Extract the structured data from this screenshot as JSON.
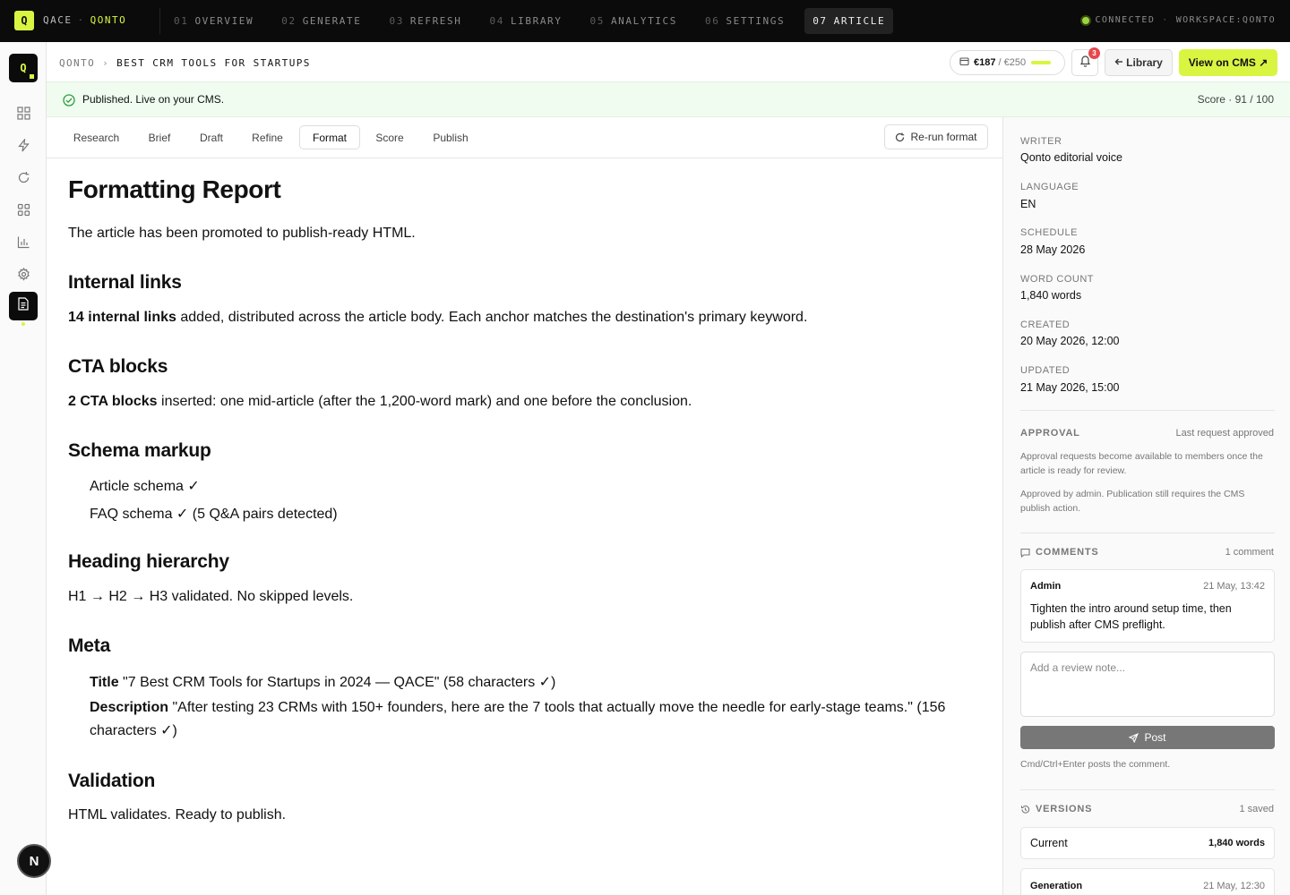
{
  "topbar": {
    "logo": "Q",
    "brand": "QACE",
    "separator": "·",
    "workspace": "QONTO",
    "nav": [
      {
        "num": "01",
        "label": "OVERVIEW"
      },
      {
        "num": "02",
        "label": "GENERATE"
      },
      {
        "num": "03",
        "label": "REFRESH"
      },
      {
        "num": "04",
        "label": "LIBRARY"
      },
      {
        "num": "05",
        "label": "ANALYTICS"
      },
      {
        "num": "06",
        "label": "SETTINGS"
      },
      {
        "num": "07",
        "label": "ARTICLE"
      }
    ],
    "status": "CONNECTED",
    "status_sep": "·",
    "workspace_label": "WORKSPACE:QONTO"
  },
  "rail": {
    "logo": "Q",
    "icons": [
      "grid-icon",
      "bolt-icon",
      "refresh-icon",
      "apps-icon",
      "chart-icon",
      "gear-icon",
      "document-icon"
    ],
    "avatar": "N"
  },
  "header": {
    "breadcrumb_root": "QONTO",
    "breadcrumb_chevron": "›",
    "breadcrumb_current": "BEST CRM TOOLS FOR STARTUPS",
    "budget_used": "€187",
    "budget_total": "/ €250",
    "notifications": "3",
    "library_label": "Library",
    "cms_label": "View on CMS ↗"
  },
  "banner": {
    "message": "Published. Live on your CMS.",
    "score": "Score · 91 / 100"
  },
  "tabs": [
    "Research",
    "Brief",
    "Draft",
    "Refine",
    "Format",
    "Score",
    "Publish"
  ],
  "active_tab": "Format",
  "rerun_label": "Re-run format",
  "article": {
    "title": "Formatting Report",
    "intro": "The article has been promoted to publish-ready HTML.",
    "links_heading": "Internal links",
    "links_bold": "14 internal links",
    "links_text": " added, distributed across the article body. Each anchor matches the destination's primary keyword.",
    "cta_heading": "CTA blocks",
    "cta_bold": "2 CTA blocks",
    "cta_text": " inserted: one mid-article (after the 1,200-word mark) and one before the conclusion.",
    "schema_heading": "Schema markup",
    "schema_items": [
      "Article schema ✓",
      "FAQ schema ✓ (5 Q&A pairs detected)"
    ],
    "hierarchy_heading": "Heading hierarchy",
    "hierarchy_text": "H1 → H2 → H3 validated. No skipped levels.",
    "meta_heading": "Meta",
    "meta_title_label": "Title",
    "meta_title_value": " \"7 Best CRM Tools for Startups in 2024 — QACE\" (58 characters ✓)",
    "meta_desc_label": "Description",
    "meta_desc_value": " \"After testing 23 CRMs with 150+ founders, here are the 7 tools that actually move the needle for early-stage teams.\" (156 characters ✓)",
    "validation_heading": "Validation",
    "validation_text": "HTML validates. Ready to publish."
  },
  "panel": {
    "writer_label": "WRITER",
    "writer": "Qonto editorial voice",
    "language_label": "LANGUAGE",
    "language": "EN",
    "schedule_label": "SCHEDULE",
    "schedule": "28 May 2026",
    "wordcount_label": "WORD COUNT",
    "wordcount": "1,840 words",
    "created_label": "CREATED",
    "created": "20 May 2026, 12:00",
    "updated_label": "UPDATED",
    "updated": "21 May 2026, 15:00",
    "approval_label": "APPROVAL",
    "approval_status": "Last request approved",
    "approval_note1": "Approval requests become available to members once the article is ready for review.",
    "approval_note2": "Approved by admin. Publication still requires the CMS publish action.",
    "comments_label": "COMMENTS",
    "comments_count": "1 comment",
    "comment": {
      "author": "Admin",
      "time": "21 May, 13:42",
      "body": "Tighten the intro around setup time, then publish after CMS preflight."
    },
    "note_placeholder": "Add a review note...",
    "post_label": "Post",
    "hint": "Cmd/Ctrl+Enter posts the comment.",
    "versions_label": "VERSIONS",
    "versions_count": "1 saved",
    "versions": [
      {
        "label": "Current",
        "meta": "1,840 words"
      },
      {
        "label": "Generation",
        "meta": "21 May, 12:30"
      }
    ]
  }
}
